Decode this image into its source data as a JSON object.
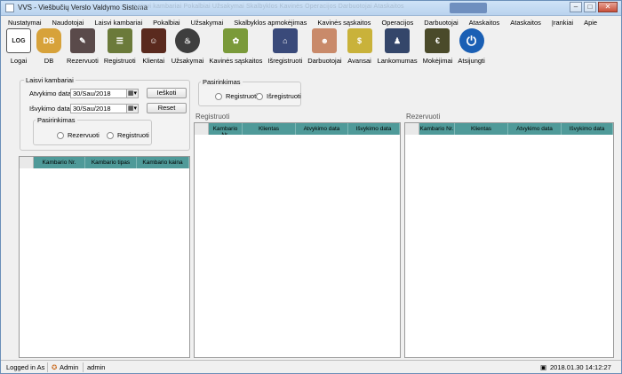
{
  "window": {
    "title": "VVS - Viešbučių Verslo Valdymo Sistema",
    "ghost_text": "Laisvi kambariai    Pokalbiai    Užsakymai    Skalbyklos    Kavinės    Operacijos    Darbuotojai    Ataskaitos",
    "minimize": "–",
    "maximize": "□",
    "close": "✕"
  },
  "menu": [
    "Nustatymai",
    "Naudotojai",
    "Laisvi kambariai",
    "Pokalbiai",
    "Užsakymai",
    "Skalbyklos apmokėjimas",
    "Kavinės sąskaitos",
    "Operacijos",
    "Darbuotojai",
    "Ataskaitos",
    "Ataskaitos",
    "Įrankiai",
    "Apie"
  ],
  "toolbar": [
    {
      "label": "Logai",
      "icon": "log-icon",
      "glyph": "LOG",
      "color": "#ffffff"
    },
    {
      "label": "DB",
      "icon": "database-icon",
      "glyph": "DB",
      "color": "#d7a23a"
    },
    {
      "label": "Rezervuoti",
      "icon": "reserve-icon",
      "glyph": "✎",
      "color": "#5a4a4a"
    },
    {
      "label": "Registruoti",
      "icon": "register-icon",
      "glyph": "☰",
      "color": "#6b7a3a"
    },
    {
      "label": "Klientai",
      "icon": "clients-icon",
      "glyph": "☺",
      "color": "#5a2a1e"
    },
    {
      "label": "Užsakymai",
      "icon": "orders-icon",
      "glyph": "♨",
      "color": "#3e3e3e"
    },
    {
      "label": "Kavinės sąskaitos",
      "icon": "cafe-bills-icon",
      "glyph": "✿",
      "color": "#7a9a3a"
    },
    {
      "label": "Išregistruoti",
      "icon": "checkout-icon",
      "glyph": "⌂",
      "color": "#3a4a7a"
    },
    {
      "label": "Darbuotojai",
      "icon": "employees-icon",
      "glyph": "☻",
      "color": "#c98a6a"
    },
    {
      "label": "Avansai",
      "icon": "advances-icon",
      "glyph": "$",
      "color": "#c9b23a"
    },
    {
      "label": "Lankomumas",
      "icon": "attendance-icon",
      "glyph": "♟",
      "color": "#34466a"
    },
    {
      "label": "Mokėjimai",
      "icon": "payments-icon",
      "glyph": "€",
      "color": "#4a4a2a"
    },
    {
      "label": "Atsijungti",
      "icon": "logout-icon",
      "glyph": "⏻",
      "color": "#1a5fb4"
    }
  ],
  "free_rooms": {
    "group_label": "Laisvi kambariai",
    "arrival_label": "Atvykimo data :",
    "arrival_value": "30/Sau/2018",
    "departure_label": "Išvykimo data :",
    "departure_value": "30/Sau/2018",
    "search_button": "Ieškoti",
    "reset_button": "Reset",
    "choice_label": "Pasirinkimas",
    "option_a": "Rezervuoti",
    "option_b": "Registruoti",
    "columns": [
      "Kambario Nr.",
      "Kambario tipas",
      "Kambario kaina"
    ]
  },
  "right_choice": {
    "label": "Pasirinkimas",
    "option_a": "Registruoti",
    "option_b": "Išregistruoti"
  },
  "registered": {
    "title": "Registruoti",
    "columns": [
      "Kambario Nr.",
      "Klientas",
      "Atvykimo data",
      "Išvykimo data"
    ]
  },
  "reserved": {
    "title": "Rezervuoti",
    "columns": [
      "Kambario Nr.",
      "Klientas",
      "Atvykimo data",
      "Išvykimo data"
    ]
  },
  "status": {
    "logged_in_label": "Logged in As :",
    "role": "Admin",
    "user": "admin",
    "datetime": "2018.01.30 14:12:27"
  }
}
